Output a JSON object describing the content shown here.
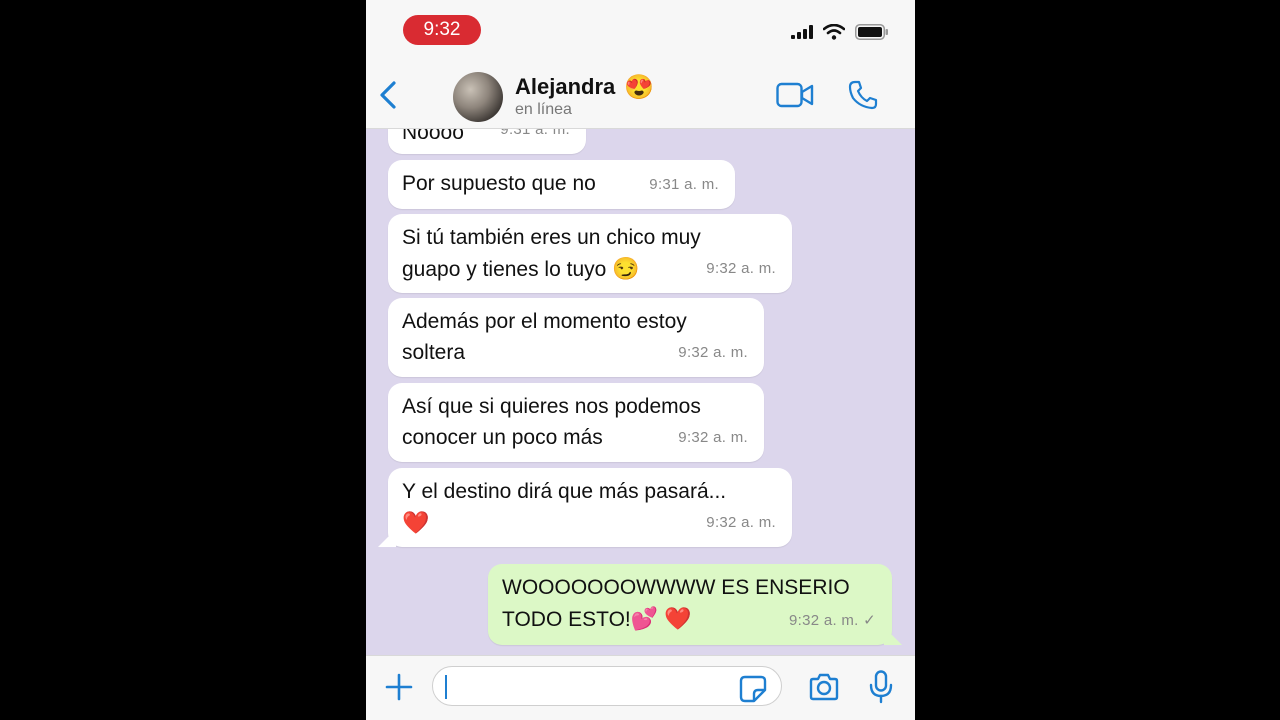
{
  "status_bar": {
    "time": "9:32"
  },
  "header": {
    "contact_name": "Alejandra",
    "name_emoji": "😍",
    "status": "en línea",
    "icons": [
      "back-chevron-icon",
      "video-call-icon",
      "phone-call-icon"
    ]
  },
  "messages": [
    {
      "direction": "in",
      "text": "Noooo",
      "time": "9:31 a. m."
    },
    {
      "direction": "in",
      "text": "Por supuesto que no",
      "time": "9:31 a. m."
    },
    {
      "direction": "in",
      "text": "Si tú también eres un chico muy\nguapo y tienes lo tuyo",
      "emoji": "😏",
      "time": "9:32 a. m."
    },
    {
      "direction": "in",
      "text": "Además por el momento estoy\nsoltera",
      "time": "9:32 a. m."
    },
    {
      "direction": "in",
      "text": "Así que si quieres nos podemos\nconocer un poco más",
      "time": "9:32 a. m."
    },
    {
      "direction": "in",
      "text": "Y el destino dirá que más pasará...",
      "emoji": "❤️",
      "time": "9:32 a. m."
    },
    {
      "direction": "out",
      "text": "WOOOOOOOWWWW ES ENSERIO\nTODO ESTO!",
      "emoji": "💕 ❤️",
      "time": "9:32 a. m.",
      "status": "sent"
    }
  ],
  "input_bar": {
    "placeholder": "",
    "icons": [
      "plus-icon",
      "sticker-icon",
      "camera-icon",
      "microphone-icon"
    ]
  },
  "colors": {
    "time_pill": "#d92b32",
    "accent_blue": "#1e7fd1",
    "chat_background": "#dcd6ec",
    "incoming_bubble": "#ffffff",
    "outgoing_bubble": "#dcf8c6"
  }
}
